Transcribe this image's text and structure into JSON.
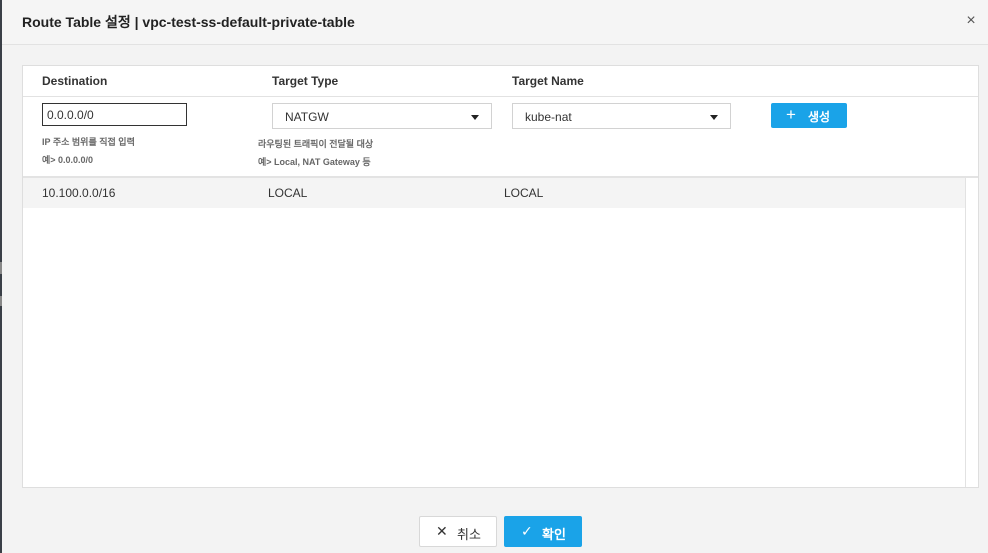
{
  "modal": {
    "title": "Route Table 설정 | vpc-test-ss-default-private-table",
    "close_icon": "×"
  },
  "columns": {
    "destination": "Destination",
    "target_type": "Target Type",
    "target_name": "Target Name"
  },
  "form": {
    "destination_value": "0.0.0.0/0",
    "destination_hint_1": "IP 주소 범위를 직접 입력",
    "destination_hint_2": "예> 0.0.0.0/0",
    "target_type_selected": "NATGW",
    "target_type_hint_1": "라우팅된 트래픽이 전달될 대상",
    "target_type_hint_2": "예> Local, NAT Gateway 등",
    "target_name_selected": "kube-nat",
    "create_label": "생성",
    "create_icon": "+"
  },
  "routes": [
    {
      "destination": "10.100.0.0/16",
      "target_type": "LOCAL",
      "target_name": "LOCAL"
    }
  ],
  "footer": {
    "cancel_label": "취소",
    "cancel_icon": "✕",
    "confirm_label": "확인",
    "confirm_icon": "✓"
  },
  "colors": {
    "primary": "#1aa3e8",
    "row_bg": "#f4f4f4"
  }
}
